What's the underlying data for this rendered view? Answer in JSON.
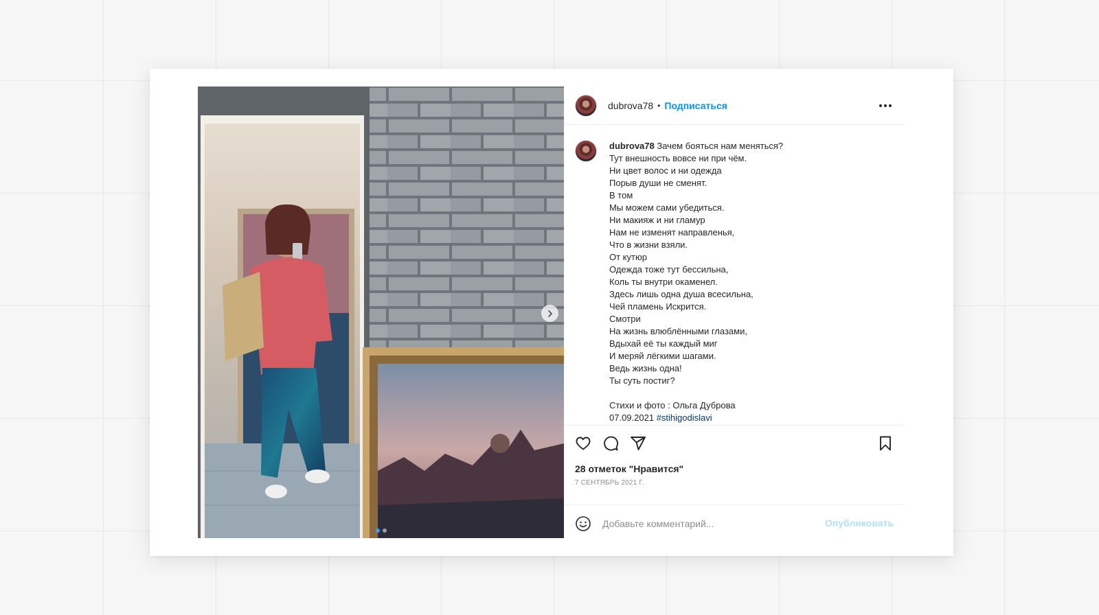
{
  "post": {
    "username": "dubrova78",
    "separator": "•",
    "follow_label": "Подписаться",
    "more_icon": "more-horizontal-icon",
    "caption": {
      "username": "dubrova78",
      "first_line": "Зачем бояться нам меняться?",
      "lines": [
        "Тут внешность вовсе ни при чём.",
        "Ни цвет волос и ни одежда",
        "Порыв души не сменят.",
        "В том",
        "Мы можем сами убедиться.",
        "Ни макияж и ни гламур",
        "Нам не изменят направленья,",
        "Что в жизни взяли.",
        "От кутюр",
        "Одежда тоже тут бессильна,",
        "Коль ты внутри окаменел.",
        "Здесь лишь одна душа всесильна,",
        "Чей пламень Искрится.",
        "Смотри",
        "На жизнь влюблёнными глазами,",
        "Вдыхай её ты каждый миг",
        "И меряй лёгкими шагами.",
        "Ведь жизнь одна!",
        "Ты суть постиг?"
      ],
      "credits": "Стихи и фото : Ольга Дуброва",
      "date_line": "07.09.2021",
      "hashtag": "#stihigodislavi"
    },
    "likes_text": "28 отметок \"Нравится\"",
    "date": "7 сентябрь 2021 г.",
    "comment_placeholder": "Добавьте комментарий...",
    "publish_label": "Опубликовать",
    "carousel": {
      "total_slides": 2,
      "active_slide": 1
    }
  },
  "icons": [
    "heart-icon",
    "comment-icon",
    "share-icon",
    "bookmark-icon",
    "emoji-icon",
    "chevron-right-icon"
  ],
  "colors": {
    "link_blue": "#0095f6",
    "publish_disabled": "#b2dffc",
    "hashtag": "#00376b",
    "muted": "#8e8e8e"
  }
}
